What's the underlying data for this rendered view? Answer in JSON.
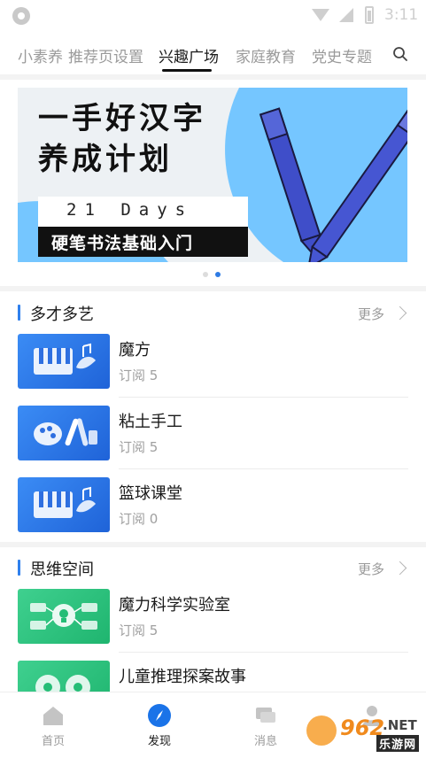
{
  "status_bar": {
    "time": "3:11"
  },
  "tabs": {
    "items": [
      {
        "label": "小素养"
      },
      {
        "label": "推荐页设置"
      },
      {
        "label": "兴趣广场"
      },
      {
        "label": "家庭教育"
      },
      {
        "label": "党史专题"
      }
    ],
    "active_index": 2,
    "search_icon": "search-icon"
  },
  "banner": {
    "title_line1": "一手好汉字",
    "title_line2": "养成计划",
    "days": "21 Days",
    "subtitle": "硬笔书法基础入门",
    "page_count": 2,
    "active_page": 1,
    "colors": {
      "accent_blue": "#6ec0ff",
      "pen": "#3f4ec9"
    }
  },
  "sections": [
    {
      "title": "多才多艺",
      "more_label": "更多",
      "items": [
        {
          "title": "魔方",
          "subtitle": "订阅 5",
          "thumb": "piano-music-icon"
        },
        {
          "title": "粘土手工",
          "subtitle": "订阅 5",
          "thumb": "art-tools-icon"
        },
        {
          "title": "篮球课堂",
          "subtitle": "订阅 0",
          "thumb": "piano-music-icon"
        }
      ]
    },
    {
      "title": "思维空间",
      "more_label": "更多",
      "items": [
        {
          "title": "魔力科学实验室",
          "subtitle": "订阅 5",
          "thumb": "idea-network-icon"
        },
        {
          "title": "儿童推理探案故事",
          "subtitle": "",
          "thumb": "gears-icon"
        }
      ]
    }
  ],
  "bottom_nav": {
    "items": [
      {
        "label": "首页",
        "icon": "home-icon"
      },
      {
        "label": "发现",
        "icon": "compass-icon"
      },
      {
        "label": "消息",
        "icon": "chat-icon"
      },
      {
        "label": "",
        "icon": "profile-icon"
      }
    ],
    "active_index": 1
  },
  "watermark": {
    "number": "962",
    "suffix": ".NET",
    "text": "乐游网"
  },
  "colors": {
    "accent": "#2f80ed",
    "active_nav": "#1a73e8"
  }
}
